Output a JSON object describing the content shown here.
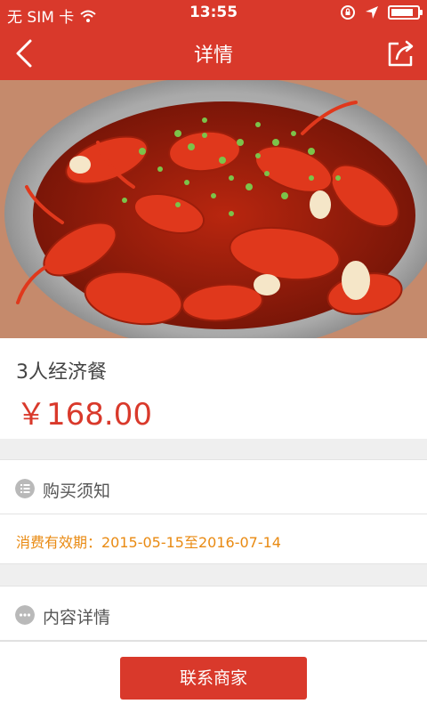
{
  "status_bar": {
    "carrier": "无 SIM 卡",
    "time": "13:55",
    "battery_level": 0.85
  },
  "nav": {
    "title": "详情",
    "back_icon": "chevron-left-icon",
    "share_icon": "share-icon"
  },
  "hero": {
    "image": "crayfish-dish-photo"
  },
  "product": {
    "name": "3人经济餐",
    "price": "￥168.00"
  },
  "notice": {
    "title": "购买须知",
    "icon": "list-icon",
    "validity": "消费有效期：2015-05-15至2016-07-14"
  },
  "details": {
    "title": "内容详情",
    "icon": "more-icon"
  },
  "bottom": {
    "contact_label": "联系商家"
  },
  "colors": {
    "brand_red": "#d9392b",
    "orange_text": "#e98a12",
    "background": "#efefef"
  }
}
